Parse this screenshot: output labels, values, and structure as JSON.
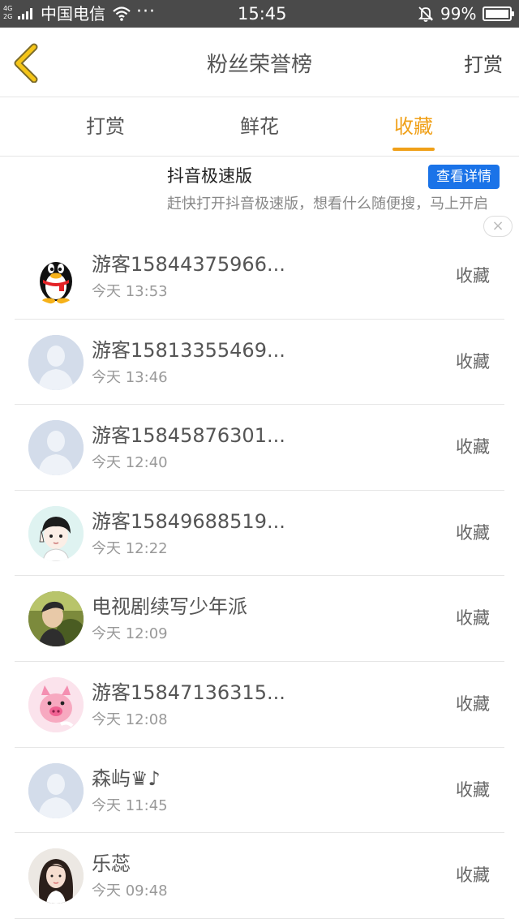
{
  "status_bar": {
    "network": "4G 2G",
    "carrier": "中国电信",
    "more": "···",
    "time": "15:45",
    "battery_pct": "99%",
    "battery_level": 0.99
  },
  "header": {
    "title": "粉丝荣誉榜",
    "right_link": "打赏",
    "back_icon": "chevron-left-icon",
    "accent_color": "#f0a018"
  },
  "tabs": [
    {
      "label": "打赏",
      "active": false
    },
    {
      "label": "鲜花",
      "active": false
    },
    {
      "label": "收藏",
      "active": true
    }
  ],
  "ad": {
    "title": "抖音极速版",
    "cta": "查看详情",
    "description": "赶快打开抖音极速版，想看什么随便搜，马上开启",
    "close_icon": "×"
  },
  "list": [
    {
      "name": "游客15844375966...",
      "time": "今天 13:53",
      "action": "收藏",
      "avatar": "penguin"
    },
    {
      "name": "游客15813355469...",
      "time": "今天 13:46",
      "action": "收藏",
      "avatar": "default"
    },
    {
      "name": "游客15845876301...",
      "time": "今天 12:40",
      "action": "收藏",
      "avatar": "default"
    },
    {
      "name": "游客15849688519...",
      "time": "今天 12:22",
      "action": "收藏",
      "avatar": "cartoon-boy"
    },
    {
      "name": "电视剧续写少年派",
      "time": "今天 12:09",
      "action": "收藏",
      "avatar": "photo"
    },
    {
      "name": "游客15847136315...",
      "time": "今天 12:08",
      "action": "收藏",
      "avatar": "pig"
    },
    {
      "name": "森屿♛♪",
      "time": "今天 11:45",
      "action": "收藏",
      "avatar": "default"
    },
    {
      "name": "乐蕊",
      "time": "今天 09:48",
      "action": "收藏",
      "avatar": "girl-photo"
    }
  ]
}
